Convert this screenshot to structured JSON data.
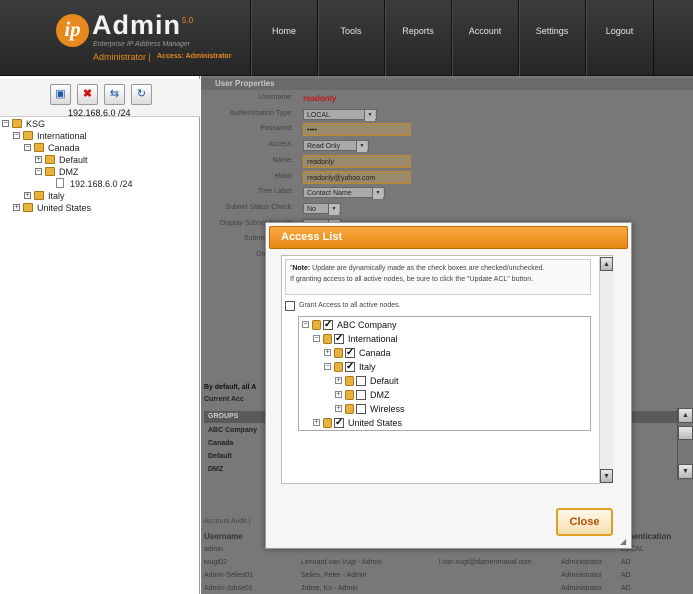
{
  "logo": {
    "ip": "ip",
    "name": "Admin",
    "version": "5.0",
    "tagline": "Enterprise IP Address Manager"
  },
  "user": {
    "role": "Administrator",
    "separator": "|",
    "access": "Access: Administrator"
  },
  "nav": [
    "Home",
    "Tools",
    "Reports",
    "Account",
    "Settings",
    "Logout"
  ],
  "left": {
    "toolbar": {
      "icons": [
        "add-subnet-icon",
        "delete-icon",
        "move-icon",
        "refresh-icon"
      ],
      "selected_ip": "192.168.6.0 /24"
    },
    "tree": [
      {
        "label": "KSG",
        "level": 0,
        "toggle": "−",
        "type": "folder"
      },
      {
        "label": "International",
        "level": 1,
        "toggle": "−",
        "type": "folder"
      },
      {
        "label": "Canada",
        "level": 2,
        "toggle": "−",
        "type": "folder"
      },
      {
        "label": "Default",
        "level": 3,
        "toggle": "+",
        "type": "folder"
      },
      {
        "label": "DMZ",
        "level": 3,
        "toggle": "−",
        "type": "folder"
      },
      {
        "label": "192.168.6.0 /24",
        "level": 4,
        "toggle": "",
        "type": "file"
      },
      {
        "label": "Italy",
        "level": 2,
        "toggle": "+",
        "type": "folder"
      },
      {
        "label": "United States",
        "level": 1,
        "toggle": "+",
        "type": "folder"
      }
    ]
  },
  "user_properties": {
    "title": "User Properties",
    "fields": [
      {
        "label": "Username:",
        "value": "readonly",
        "kind": "text-red"
      },
      {
        "label": "Authentication Type:",
        "value": "LOCAL",
        "kind": "select"
      },
      {
        "label": "Password:",
        "value": "••••",
        "kind": "input"
      },
      {
        "label": "Access:",
        "value": "Read Only",
        "kind": "select"
      },
      {
        "label": "Name:",
        "value": "readonly",
        "kind": "input"
      },
      {
        "label": "eMail:",
        "value": "readonly@yahoo.com",
        "kind": "input"
      },
      {
        "label": "Tree Label:",
        "value": "Contact Name",
        "kind": "select"
      },
      {
        "label": "Subnet Status Check:",
        "value": "No",
        "kind": "select"
      },
      {
        "label": "Display Subnet Search:",
        "value": "No",
        "kind": "select"
      },
      {
        "label": "Subnet Display:",
        "value": "",
        "kind": "select"
      },
      {
        "label": "Group Mem",
        "value": "",
        "kind": "text"
      }
    ],
    "bottom_note": "By default, all A",
    "current_access": "Current Acc",
    "groups_header": "GROUPS",
    "groups": [
      "ABC Company",
      "Canada",
      "Default",
      "DMZ"
    ]
  },
  "audit": {
    "tab": "Account Audit |",
    "columns": [
      "Username",
      "",
      "",
      "",
      "uthentication"
    ],
    "rows": [
      [
        "admin",
        "",
        "",
        "",
        "LOCAL"
      ],
      [
        "tvugt02",
        "Lennard van Vugt - Admin",
        "l.van.vugt@damenrnaval.com",
        "Administrator",
        "AD"
      ],
      [
        "Admin-Selies01",
        "Selies, Peter - Admin",
        "",
        "Administrator",
        "AD"
      ],
      [
        "Admin-Jobse01",
        "Jobse, Ko - Admin",
        "",
        "Administrator",
        "AD"
      ]
    ]
  },
  "modal": {
    "title": "Access List",
    "note_bold": "Note:",
    "note_line1": " Update are dynamically made as the check boxes are checked/unchecked.",
    "note_line2": "If granting access to all active nodes, be sure to click the \"Update ACL\" button.",
    "grant_label": "Grant Access to all active nodes.",
    "grant_checked": false,
    "tree": [
      {
        "label": "ABC Company",
        "level": 0,
        "toggle": "−",
        "checked": true
      },
      {
        "label": "International",
        "level": 1,
        "toggle": "−",
        "checked": true
      },
      {
        "label": "Canada",
        "level": 2,
        "toggle": "+",
        "checked": true
      },
      {
        "label": "Italy",
        "level": 2,
        "toggle": "−",
        "checked": true
      },
      {
        "label": "Default",
        "level": 3,
        "toggle": "+",
        "checked": false
      },
      {
        "label": "DMZ",
        "level": 3,
        "toggle": "+",
        "checked": false
      },
      {
        "label": "Wireless",
        "level": 3,
        "toggle": "+",
        "checked": false
      },
      {
        "label": "United States",
        "level": 1,
        "toggle": "+",
        "checked": true
      }
    ],
    "close_label": "Close"
  },
  "colors": {
    "accent": "#e8891e",
    "header_bg": "#2e2e2e",
    "modal_title": "#f39a2a"
  }
}
